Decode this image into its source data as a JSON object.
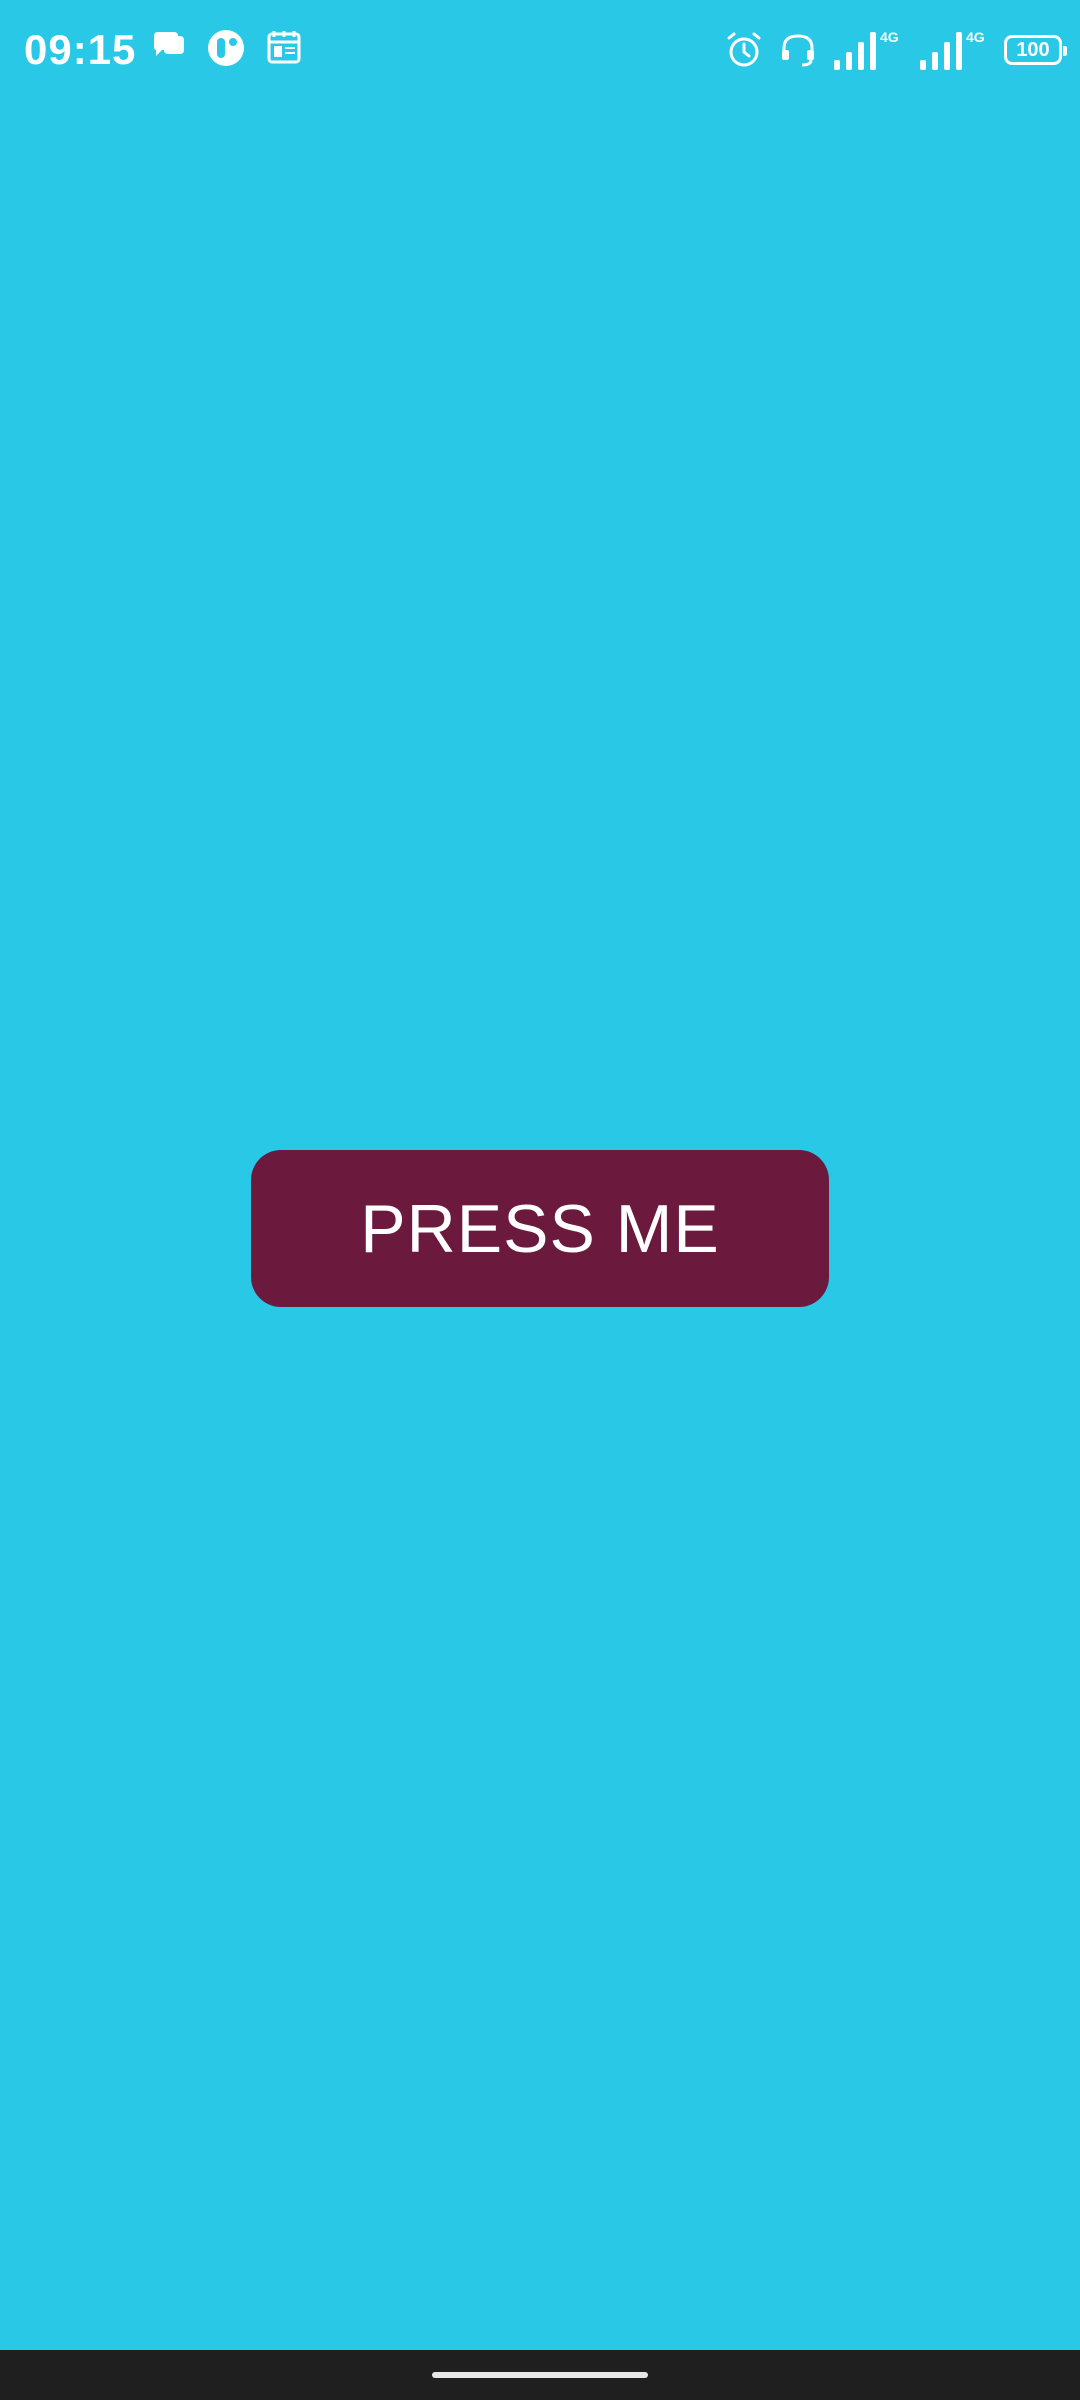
{
  "status_bar": {
    "time": "09:15",
    "left_icons": [
      "chat-bubble-icon",
      "app-circle-icon",
      "calendar-icon"
    ],
    "right_icons": [
      "alarm-icon",
      "headset-icon",
      "signal-icon",
      "signal-icon"
    ],
    "network_1": "4G",
    "network_2": "4G",
    "battery": "100"
  },
  "main": {
    "button_label": "PRESS ME"
  },
  "colors": {
    "background": "#29C8E7",
    "button": "#6B1A3E",
    "button_text": "#FFFFFF",
    "nav_bar": "#1F1F1F"
  }
}
